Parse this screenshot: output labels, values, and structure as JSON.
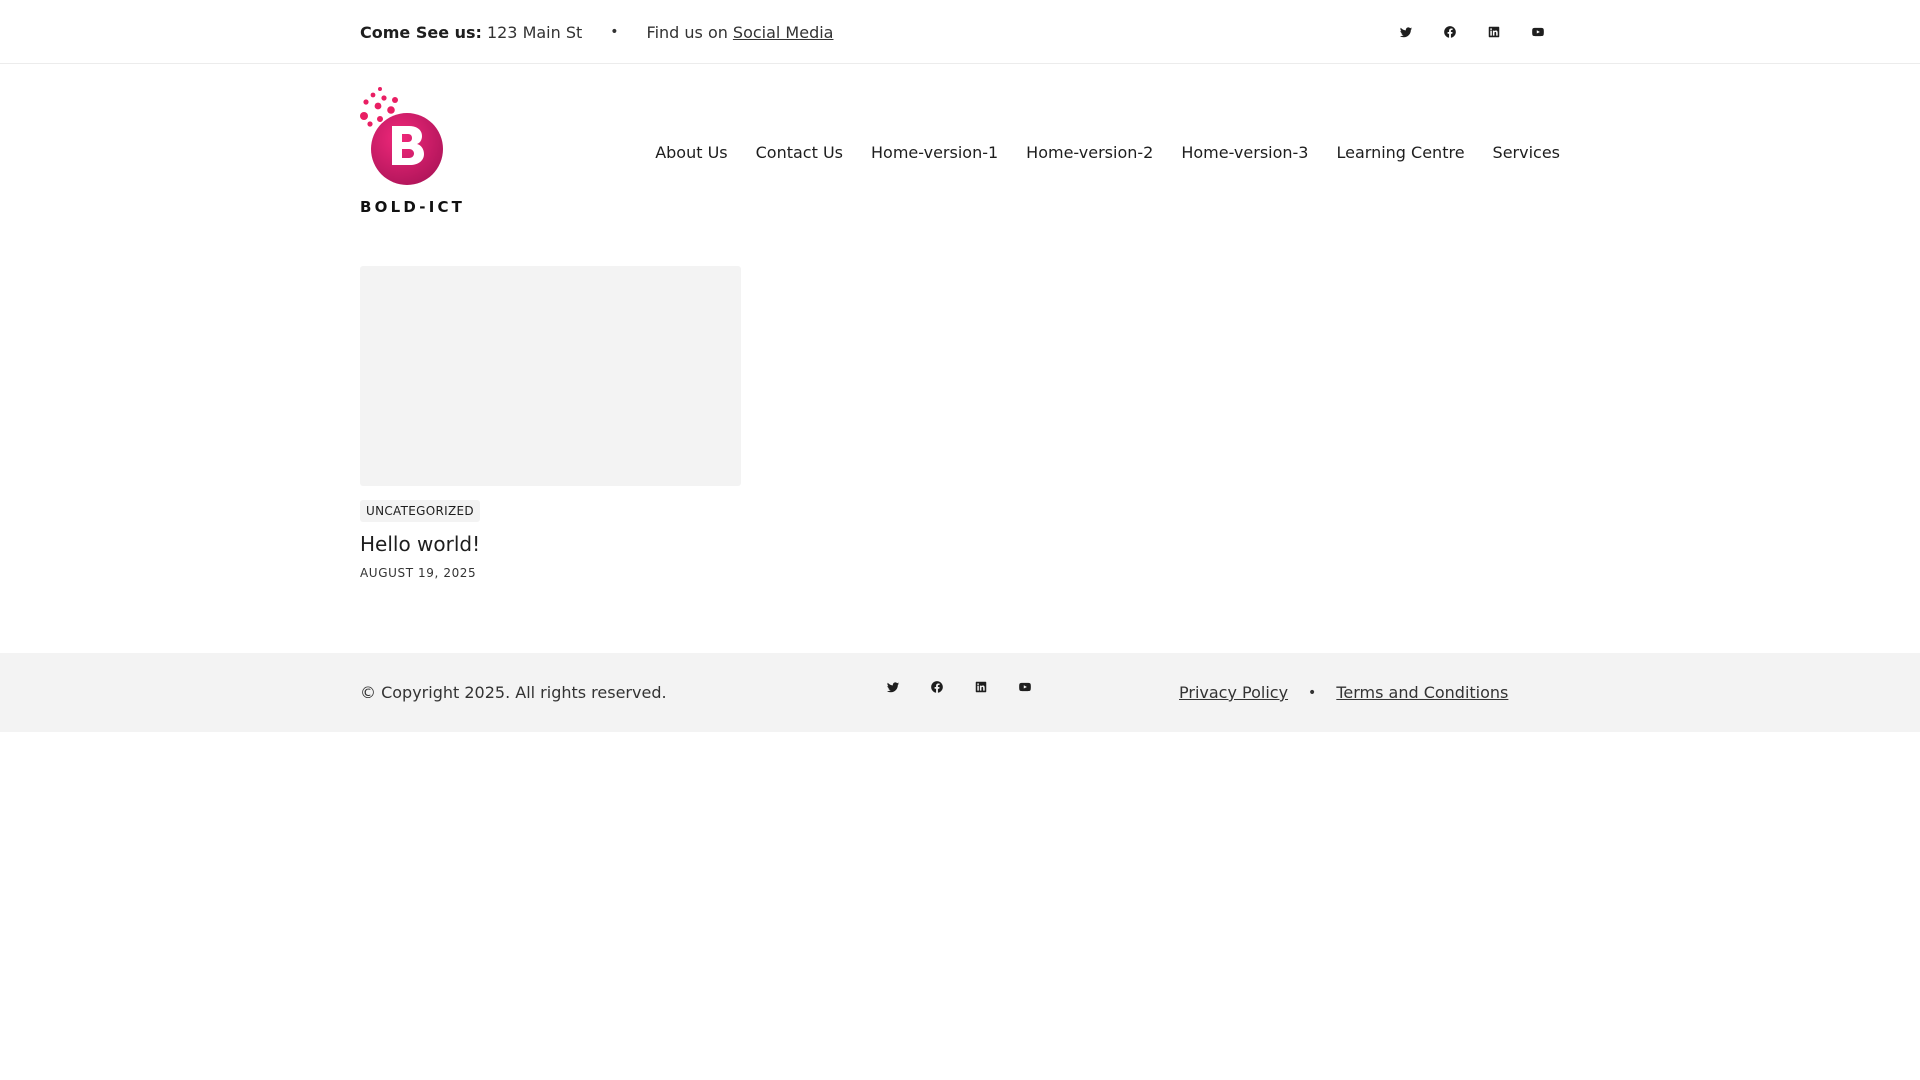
{
  "topbar": {
    "visit_label": "Come See us:",
    "address": "123 Main St",
    "separator": "•",
    "find_us_text": "Find us on",
    "social_link": "Social Media",
    "social_icons": [
      "twitter-icon",
      "facebook-icon",
      "linkedin-icon",
      "youtube-icon"
    ]
  },
  "header": {
    "logo_text": "BOLD-ICT",
    "logo_colors": {
      "gradient_start": "#f0287a",
      "gradient_end": "#c2185b"
    },
    "nav": [
      {
        "label": "About Us"
      },
      {
        "label": "Contact Us"
      },
      {
        "label": "Home-version-1"
      },
      {
        "label": "Home-version-2"
      },
      {
        "label": "Home-version-3"
      },
      {
        "label": "Learning Centre"
      },
      {
        "label": "Services"
      }
    ]
  },
  "post": {
    "category": "UNCATEGORIZED",
    "title": "Hello world!",
    "date": "AUGUST 19, 2025"
  },
  "footer": {
    "copyright": "© Copyright 2025. All rights reserved.",
    "separator": "•",
    "privacy": "Privacy Policy",
    "terms": "Terms and Conditions",
    "social_icons": [
      "twitter-icon",
      "facebook-icon",
      "linkedin-icon",
      "youtube-icon"
    ]
  }
}
